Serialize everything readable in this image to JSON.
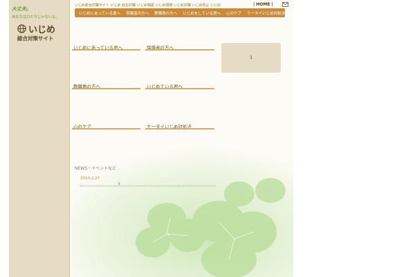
{
  "logo": {
    "tagline_top": "大丈夫。",
    "tagline_bottom": "あなたはひとりじゃないよ。",
    "title": "いじめ",
    "subtitle": "総合対策サイト"
  },
  "header": {
    "top_text": "いじめ総合対策サイト いじめ 総合対策 いじめ相談 いじめ問題 いじめ対策 いじめ防止 いじめ",
    "home_label": "| HOME |"
  },
  "nav": {
    "items": [
      "いじめにあっている君へ",
      "保護者の方へ",
      "教職員の方へ",
      "いじめをしている君へ",
      "心のケア",
      "ケータイいじめ対処法"
    ]
  },
  "sections": [
    "いじめにあっている君へ",
    "保護者の方へ",
    "教職員の方へ",
    "いじめている君へ",
    "心のケア",
    "ケータイいじめ対処法"
  ],
  "notice": {
    "text": "1"
  },
  "news": {
    "heading": "NEWS・イベントなど",
    "date": "2010.2.27",
    "marker": "①"
  },
  "colors": {
    "nav_bg": "#c98a3a",
    "side_bg": "#e6dcc3",
    "accent_line": "#d8a96a",
    "date_color": "#c88a3a"
  }
}
